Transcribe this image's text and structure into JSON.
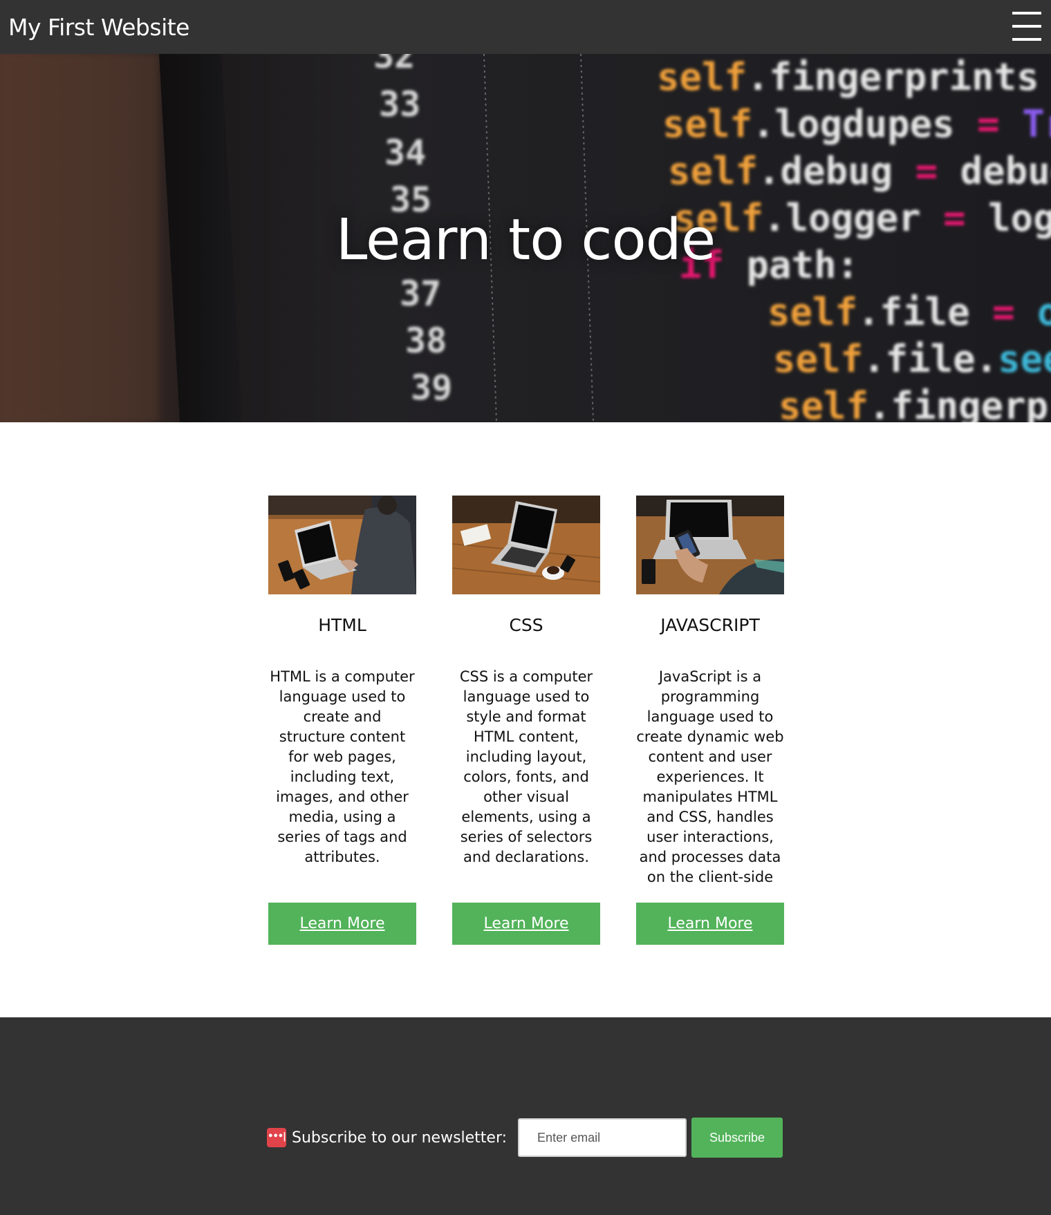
{
  "header": {
    "title": "My First Website",
    "menu_icon": "hamburger-menu-icon"
  },
  "hero": {
    "title": "Learn to code",
    "background": "code-editor-screenshot"
  },
  "cards": [
    {
      "image": "laptop-typing-photo",
      "title": "HTML",
      "text": "HTML is a computer language used to create and structure content for web pages, including text, images, and other media, using a series of tags and attributes.",
      "button_label": "Learn More"
    },
    {
      "image": "laptop-desk-photo",
      "title": "CSS",
      "text": "CSS is a computer language used to style and format HTML content, including layout, colors, fonts, and other visual elements, using a series of selectors and declarations.",
      "button_label": "Learn More"
    },
    {
      "image": "phone-laptop-photo",
      "title": "JAVASCRIPT",
      "text": "JavaScript is a programming language used to create dynamic web content and user experiences. It manipulates HTML and CSS, handles user interactions, and processes data on the client-side",
      "button_label": "Learn More"
    }
  ],
  "footer": {
    "newsletter_icon": "password-manager-icon",
    "newsletter_icon_glyph": "•••|",
    "newsletter_label": "Subscribe to our newsletter:",
    "email_placeholder": "Enter email",
    "subscribe_label": "Subscribe"
  },
  "colors": {
    "header_bg": "#333333",
    "accent_green": "#52b35a",
    "footer_bg": "#333333"
  }
}
